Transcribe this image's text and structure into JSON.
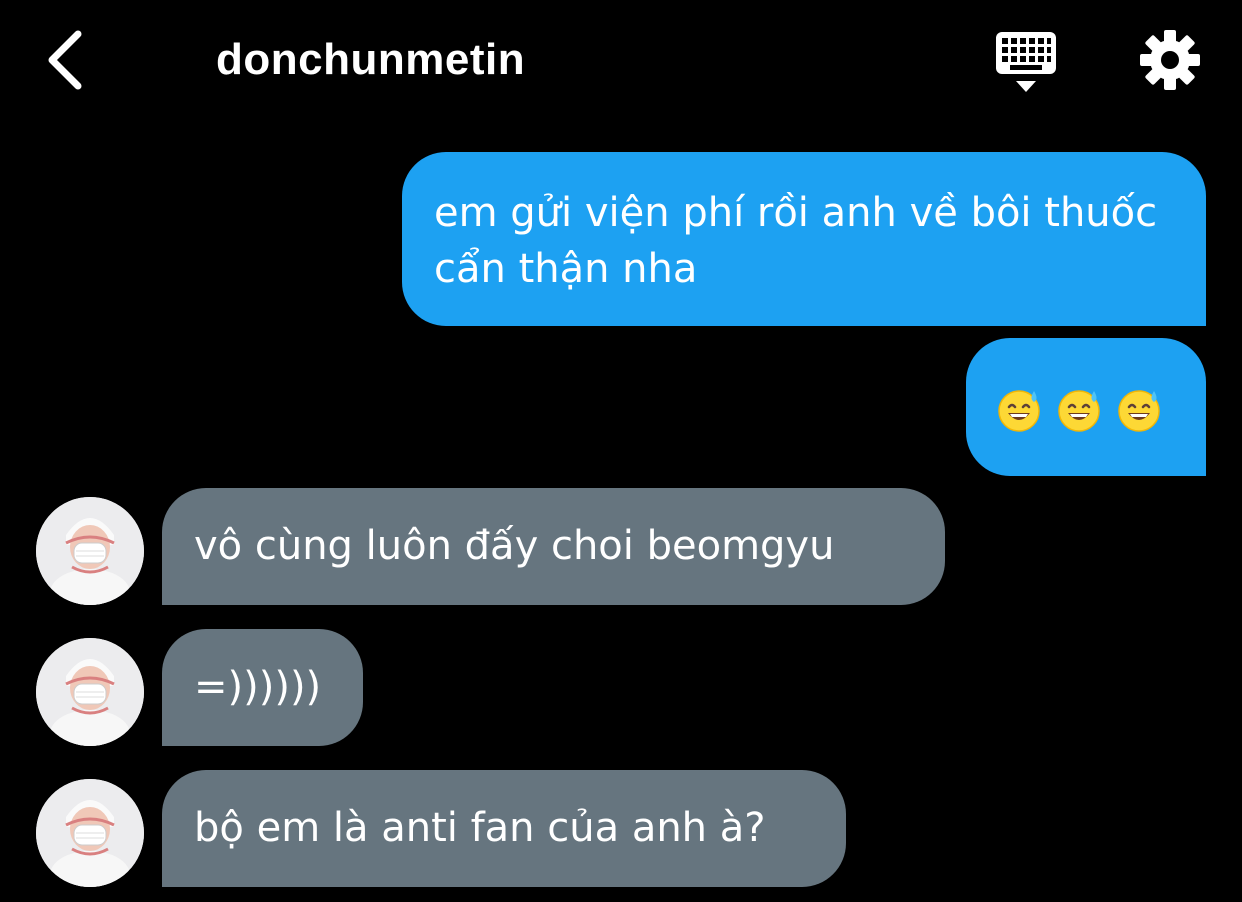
{
  "header": {
    "title": "donchunmetin",
    "back_icon": "chevron-left-icon",
    "keyboard_icon": "keyboard-icon",
    "settings_icon": "gear-icon"
  },
  "messages": [
    {
      "direction": "outgoing",
      "text": "em gửi viện phí rồi anh về bôi thuốc cẩn thận nha"
    },
    {
      "direction": "outgoing",
      "emoji": [
        "grinning-face-with-sweat",
        "grinning-face-with-sweat",
        "grinning-face-with-sweat"
      ]
    },
    {
      "direction": "incoming",
      "text": "vô cùng luôn đấy choi beomgyu"
    },
    {
      "direction": "incoming",
      "text": "=))))))"
    },
    {
      "direction": "incoming",
      "text": "bộ em là anti fan của anh à?"
    }
  ],
  "colors": {
    "background": "#000000",
    "outgoing_bubble": "#1da1f2",
    "incoming_bubble": "#66757f",
    "text": "#ffffff"
  }
}
